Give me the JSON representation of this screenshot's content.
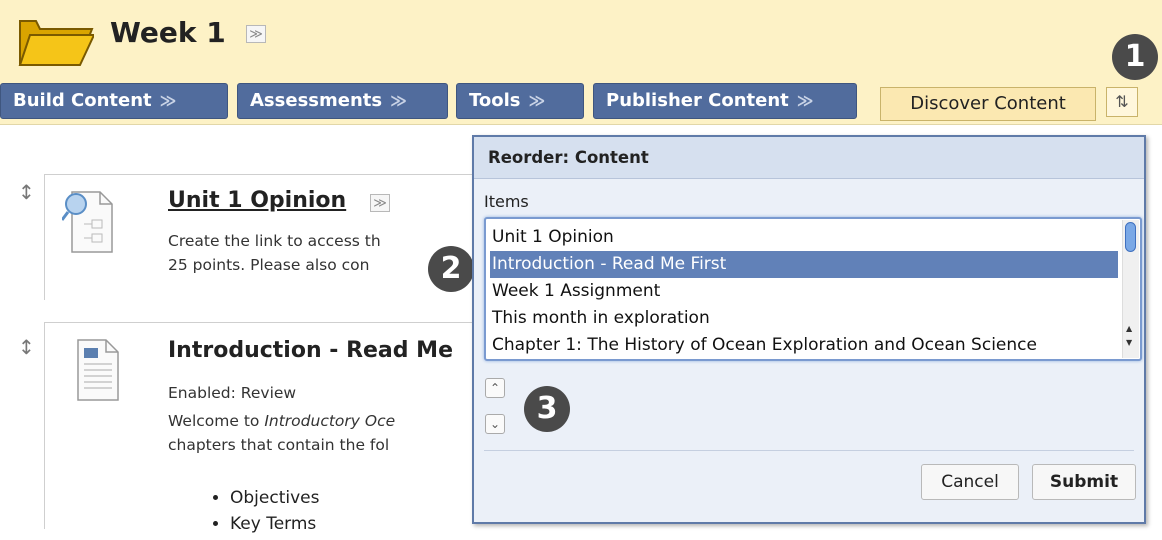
{
  "header": {
    "title": "Week 1",
    "title_menu_icon": "double-chevron-down-icon",
    "folder_icon": "folder-icon"
  },
  "toolbar": {
    "build_content": "Build Content",
    "assessments": "Assessments",
    "tools": "Tools",
    "publisher_content": "Publisher Content",
    "discover_content": "Discover Content",
    "reorder_icon": "up-down-arrows-icon",
    "menu_chevron": "≫"
  },
  "callouts": [
    "1",
    "2",
    "3"
  ],
  "content_items": [
    {
      "title": "Unit 1 Opinion",
      "desc_lines": [
        "Create the link to access th",
        "25 points. Please also con"
      ]
    },
    {
      "title": "Introduction - Read Me",
      "status": "Enabled:  Review",
      "desc_prefix": "Welcome to ",
      "desc_italic": "Introductory Oce",
      "desc_line2": "chapters that contain the fol",
      "bullets": [
        "Objectives",
        "Key Terms"
      ]
    }
  ],
  "reorder_dialog": {
    "title": "Reorder: Content",
    "items_label": "Items",
    "items": [
      "Unit 1 Opinion",
      "Introduction - Read Me First",
      "Week 1 Assignment",
      "This month in exploration",
      "Chapter 1: The History of Ocean Exploration and Ocean Science"
    ],
    "selected_index": 1,
    "cancel_label": "Cancel",
    "submit_label": "Submit"
  }
}
